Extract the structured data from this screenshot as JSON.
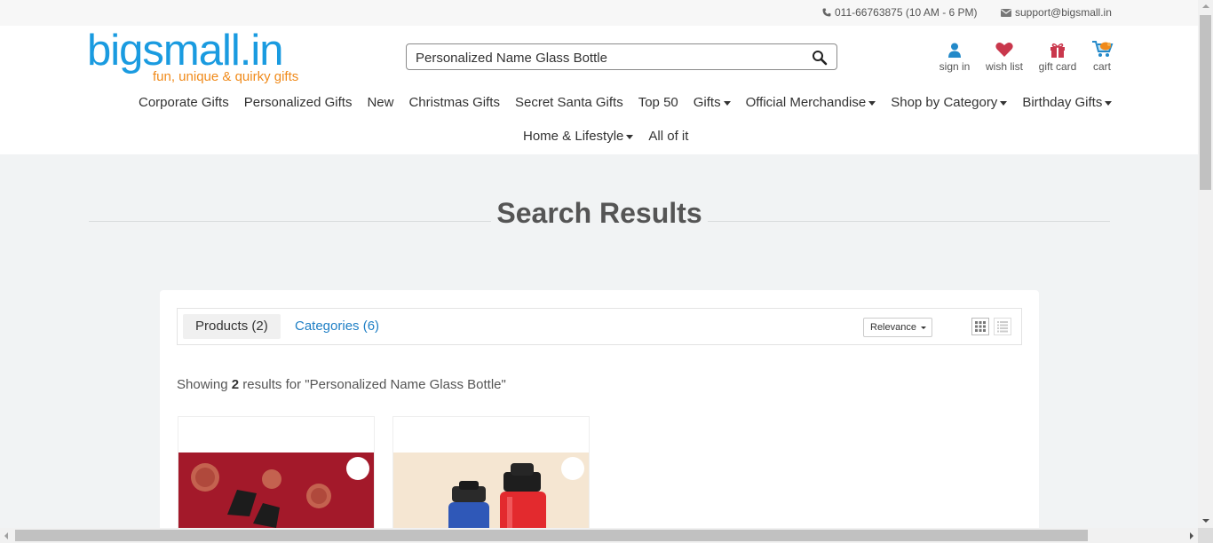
{
  "topbar": {
    "phone": "011-66763875 (10 AM - 6 PM)",
    "email": "support@bigsmall.in"
  },
  "logo": {
    "wordmark": "bigsmall.in",
    "tagline": "fun, unique & quirky gifts"
  },
  "search": {
    "value": "Personalized Name Glass Bottle",
    "icon": "search-icon"
  },
  "header_icons": [
    {
      "label": "sign in",
      "icon": "user-icon"
    },
    {
      "label": "wish list",
      "icon": "heart-icon"
    },
    {
      "label": "gift card",
      "icon": "gift-icon"
    },
    {
      "label": "cart",
      "icon": "cart-icon"
    }
  ],
  "nav": {
    "row1": [
      {
        "label": "Corporate Gifts",
        "dropdown": false
      },
      {
        "label": "Personalized Gifts",
        "dropdown": false
      },
      {
        "label": "New",
        "dropdown": false
      },
      {
        "label": "Christmas Gifts",
        "dropdown": false
      },
      {
        "label": "Secret Santa Gifts",
        "dropdown": false
      },
      {
        "label": "Top 50",
        "dropdown": false
      },
      {
        "label": "Gifts",
        "dropdown": true
      },
      {
        "label": "Official Merchandise",
        "dropdown": true
      },
      {
        "label": "Shop by Category",
        "dropdown": true
      },
      {
        "label": "Birthday Gifts",
        "dropdown": true
      }
    ],
    "row2": [
      {
        "label": "Home & Lifestyle",
        "dropdown": true
      },
      {
        "label": "All of it",
        "dropdown": false
      }
    ]
  },
  "page": {
    "title": "Search Results"
  },
  "results": {
    "tabs": [
      {
        "label": "Products (2)",
        "active": true
      },
      {
        "label": "Categories (6)",
        "active": false
      }
    ],
    "sort_value": "Relevance",
    "prefix": "Showing ",
    "count": "2",
    "suffix": " results for \"Personalized Name Glass Bottle\""
  },
  "colors": {
    "brand_blue": "#1a9be0",
    "brand_orange": "#f08a1a",
    "link_blue": "#1f7fc5",
    "heart": "#c9374c",
    "gift": "#c9374c",
    "user": "#2389c9",
    "page_bg": "#f1f3f4"
  }
}
